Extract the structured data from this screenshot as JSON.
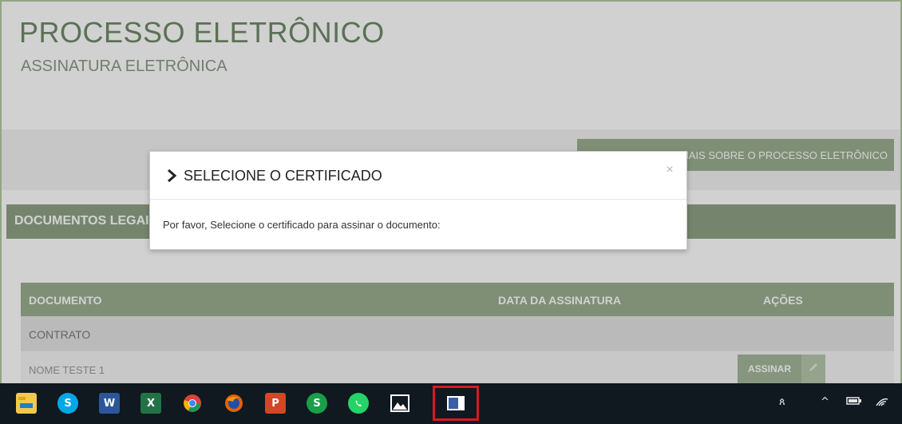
{
  "page": {
    "title": "PROCESSO ELETRÔNICO",
    "subtitle": "ASSINATURA ELETRÔNICA",
    "info_button": "SAIBA MAIS SOBRE O PROCESSO ELETRÔNICO",
    "section_title": "DOCUMENTOS LEGAIS"
  },
  "table": {
    "headers": [
      "DOCUMENTO",
      "DATA DA ASSINATURA",
      "AÇÕES"
    ],
    "group": "CONTRATO",
    "rows": [
      {
        "name": "NOME TESTE 1",
        "action": "ASSINAR"
      }
    ]
  },
  "modal": {
    "title": "SELECIONE O CERTIFICADO",
    "close": "×",
    "body": "Por favor, Selecione o certificado para assinar o documento:"
  },
  "taskbar": {
    "apps": [
      "file-explorer-icon",
      "skype-icon",
      "word-icon",
      "excel-icon",
      "chrome-icon",
      "firefox-icon",
      "powerpoint-icon",
      "skype-business-icon",
      "whatsapp-icon",
      "photos-icon",
      "active-app-icon"
    ],
    "tray": [
      "people-icon",
      "chevron-up-icon",
      "battery-icon",
      "wifi-icon"
    ]
  },
  "colors": {
    "accent": "#8fa386",
    "highlight": "#d71920",
    "taskbar": "#101820"
  }
}
